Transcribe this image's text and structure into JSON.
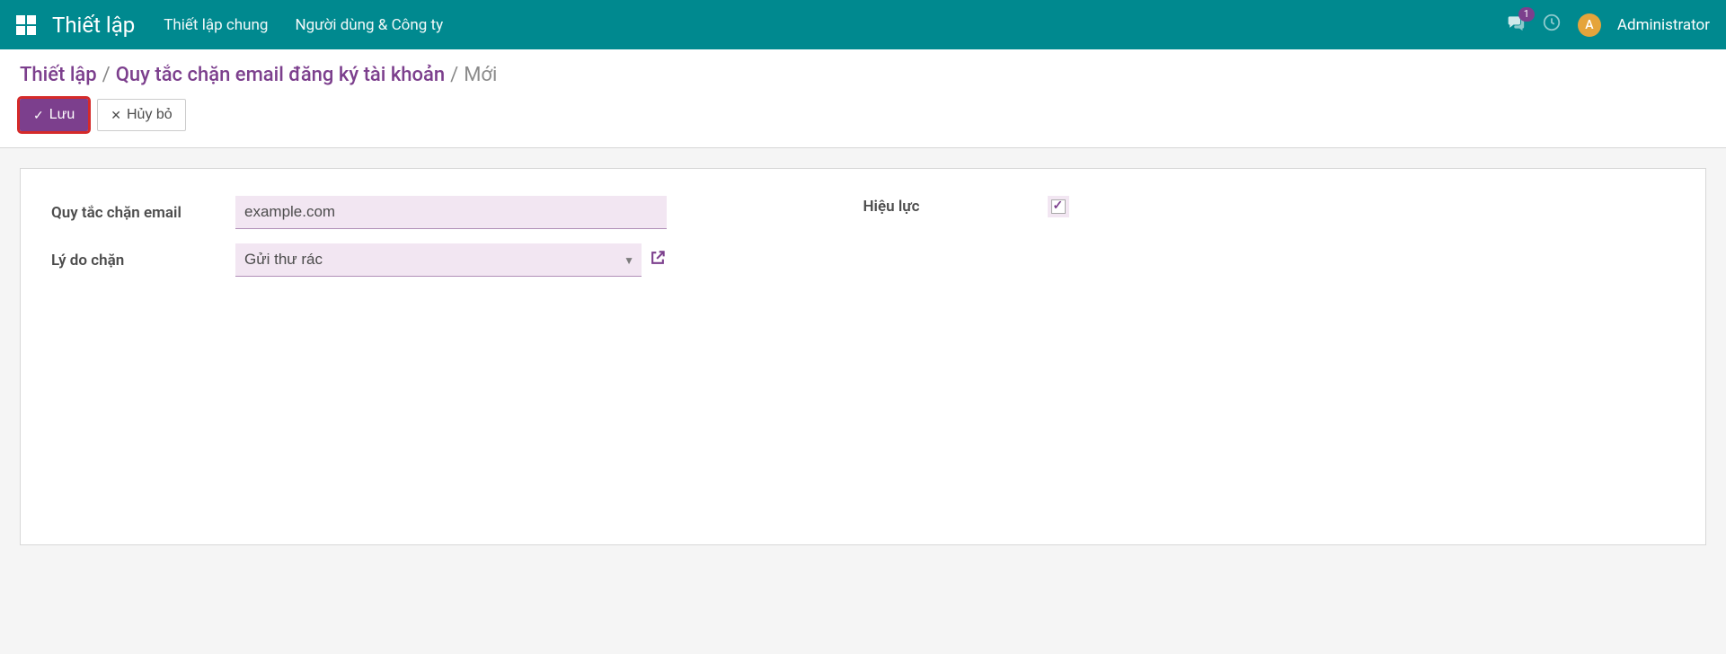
{
  "nav": {
    "brand": "Thiết lập",
    "links": [
      "Thiết lập chung",
      "Người dùng & Công ty"
    ],
    "badge": "1",
    "avatar_initial": "A",
    "user": "Administrator"
  },
  "breadcrumb": {
    "items": [
      "Thiết lập",
      "Quy tắc chặn email đăng ký tài khoản"
    ],
    "current": "Mới"
  },
  "buttons": {
    "save": "Lưu",
    "discard": "Hủy bỏ"
  },
  "form": {
    "rule_label": "Quy tắc chặn email",
    "rule_value": "example.com",
    "reason_label": "Lý do chặn",
    "reason_value": "Gửi thư rác",
    "active_label": "Hiệu lực",
    "active_checked": true
  }
}
